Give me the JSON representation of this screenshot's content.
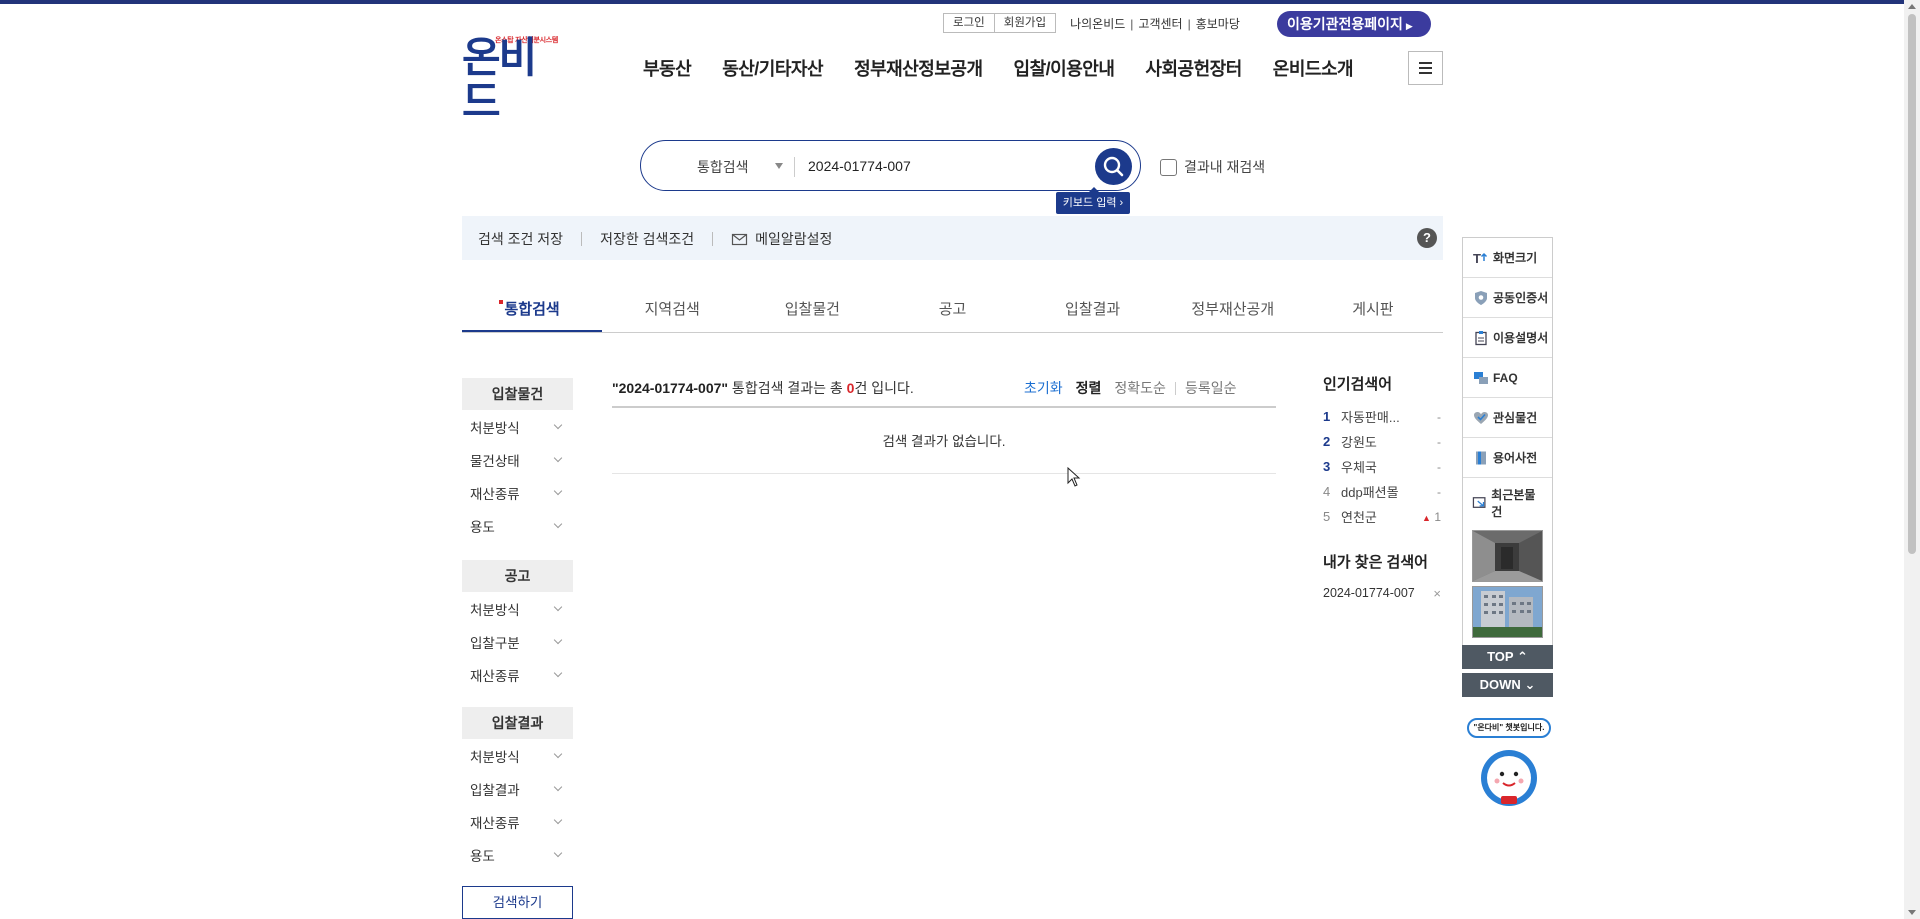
{
  "header": {
    "logo_tag": "온스탑 자산처분시스템",
    "logo_text": "온비드",
    "login": "로그인",
    "join": "회원가입",
    "util_links": [
      "나의온비드",
      "고객센터",
      "홍보마당"
    ],
    "org_page": "이용기관전용페이지",
    "gnb": [
      "부동산",
      "동산/기타자산",
      "정부재산정보공개",
      "입찰/이용안내",
      "사회공헌장터",
      "온비드소개"
    ]
  },
  "search": {
    "scope": "통합검색",
    "query": "2024-01774-007",
    "keyboard": "키보드 입력",
    "research_label": "결과내 재검색"
  },
  "conditions": {
    "save": "검색 조건 저장",
    "saved": "저장한 검색조건",
    "mail": "메일알람설정",
    "help": "?"
  },
  "tabs": [
    "통합검색",
    "지역검색",
    "입찰물건",
    "공고",
    "입찰결과",
    "정부재산공개",
    "게시판"
  ],
  "filters": [
    {
      "title": "입찰물건",
      "rows": [
        "처분방식",
        "물건상태",
        "재산종류",
        "용도"
      ]
    },
    {
      "title": "공고",
      "rows": [
        "처분방식",
        "입찰구분",
        "재산종류"
      ]
    },
    {
      "title": "입찰결과",
      "rows": [
        "처분방식",
        "입찰결과",
        "재산종류",
        "용도"
      ]
    }
  ],
  "filter_button": "검색하기",
  "result": {
    "keyword": "\"2024-01774-007\"",
    "text_mid": " 통합검색 결과는 총 ",
    "count": "0",
    "text_end": "건 입니다.",
    "reset": "초기화",
    "sort_label": "정렬",
    "sort_options": [
      "정확도순",
      "등록일순"
    ],
    "empty": "검색 결과가 없습니다."
  },
  "popular": {
    "title": "인기검색어",
    "items": [
      {
        "rank": "1",
        "word": "자동판매...",
        "delta": "-"
      },
      {
        "rank": "2",
        "word": "강원도",
        "delta": "-"
      },
      {
        "rank": "3",
        "word": "우체국",
        "delta": "-"
      },
      {
        "rank": "4",
        "word": "ddp패션몰",
        "delta": "-"
      },
      {
        "rank": "5",
        "word": "연천군",
        "delta": "1"
      }
    ]
  },
  "my_search": {
    "title": "내가 찾은 검색어",
    "keyword": "2024-01774-007",
    "remove": "×"
  },
  "quick": {
    "items": [
      "화면크기",
      "공동인증서",
      "이용설명서",
      "FAQ",
      "관심물건",
      "용어사전"
    ],
    "recent": "최근본물건",
    "top": "TOP",
    "down": "DOWN",
    "chatbot": "\"온다비\" 챗봇입니다."
  },
  "colors": {
    "brand": "#1c3a8c",
    "accent_red": "#d9262b",
    "org_button": "#3b3b9e"
  }
}
